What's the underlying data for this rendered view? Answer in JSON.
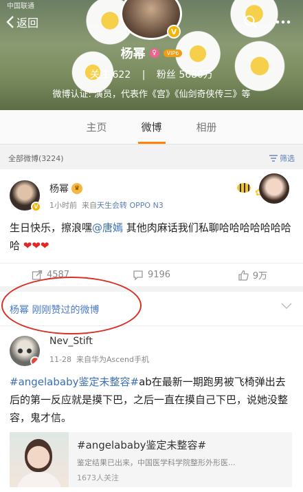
{
  "status_bar": {
    "carrier": "中国联通"
  },
  "header": {
    "back_label": "返回",
    "user_name": "杨幂",
    "verified_mark": "V",
    "vip_badge": "VIP6",
    "follow_label": "关注",
    "follow_count": "622",
    "separator": "|",
    "fans_label": "粉丝",
    "fans_count": "5680万",
    "verification": "微博认证: 演员，代表作《宫》《仙剑奇侠传三》等"
  },
  "tabs": [
    {
      "label": "主页"
    },
    {
      "label": "微博",
      "active": true
    },
    {
      "label": "相册"
    }
  ],
  "filter": {
    "all_posts_label": "全部微博(3224)",
    "filter_label": "筛选"
  },
  "post1": {
    "author": "杨幂",
    "time": "1小时前",
    "source_prefix": "来自",
    "source": "天生会转 OPPO N3",
    "text_before_mention": "生日快乐，擦浪嘿",
    "mention": "@唐嫣",
    "text_after_mention": " 其他肉麻话我们私聊哈哈哈哈哈哈哈哈",
    "hearts": "❤❤❤",
    "repost_count": "4587",
    "comment_count": "9196",
    "like_count": "9万"
  },
  "liked_section": {
    "title": "杨幂 刚刚赞过的微博"
  },
  "post2": {
    "author": "Nev_Stift",
    "time": "11-28",
    "source_prefix": "来自",
    "source": "华为Ascend手机",
    "topic": "#angelababy鉴定未整容#",
    "text": "ab在最新一期跑男被飞椅弹出去后的第一反应就是摸下巴，之后一直在摸自己下巴，说她没整容，鬼才信。",
    "repost_card": {
      "title": "#angelababy鉴定未整容#",
      "description": "鉴定结果已出来，中国医学科学院整形外形医...",
      "followers": "1673人关注"
    }
  },
  "colors": {
    "accent": "#ff8200",
    "link": "#3b6fb6",
    "annotation": "#d93025"
  }
}
